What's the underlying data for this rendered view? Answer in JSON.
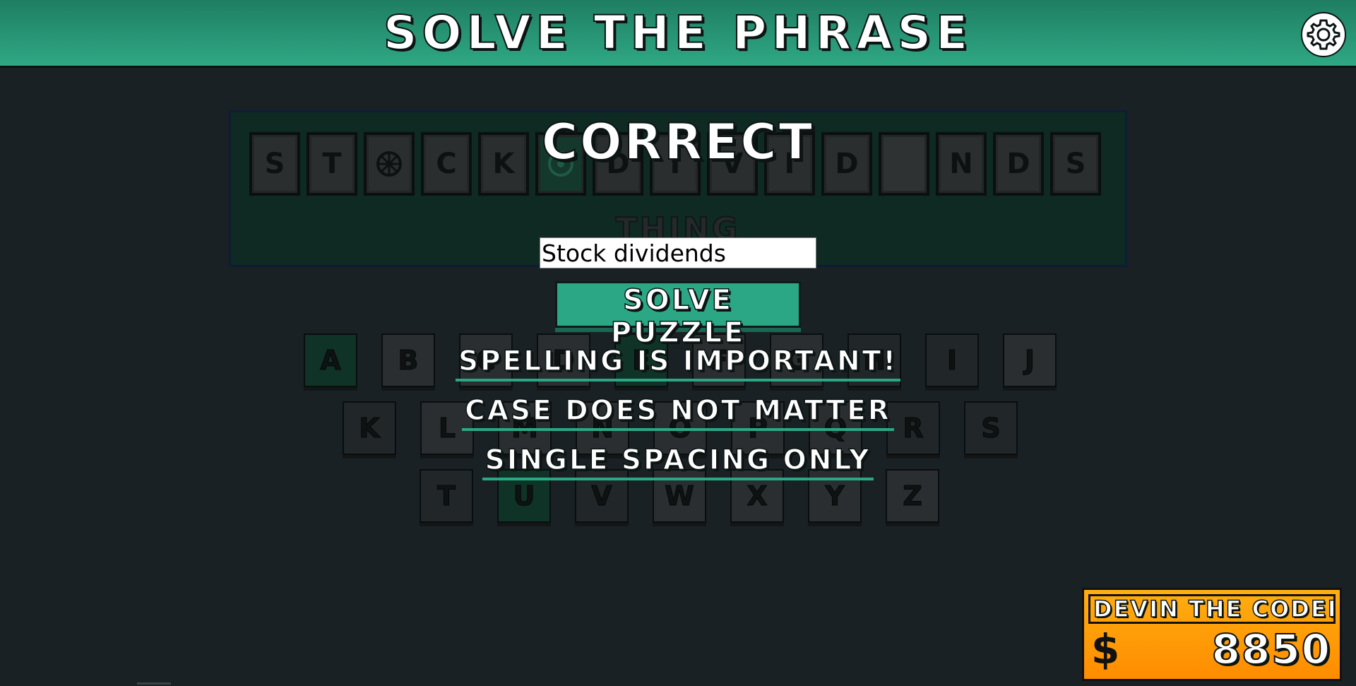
{
  "header": {
    "title": "SOLVE THE PHRASE",
    "settings_icon": "gear-icon"
  },
  "board": {
    "tiles": [
      "S",
      "T",
      "",
      "C",
      "K",
      "",
      "D",
      "I",
      "V",
      "I",
      "D",
      "",
      "N",
      "D",
      "S"
    ],
    "category": "THING"
  },
  "keyboard": {
    "row1": [
      "A",
      "B",
      "C",
      "D",
      "E",
      "F",
      "G",
      "H",
      "I",
      "J"
    ],
    "row2": [
      "K",
      "L",
      "M",
      "N",
      "O",
      "P",
      "Q",
      "R",
      "S"
    ],
    "row3": [
      "T",
      "U",
      "V",
      "W",
      "X",
      "Y",
      "Z"
    ]
  },
  "modal": {
    "title": "CORRECT",
    "input_value": "Stock dividends",
    "solve_button": "SOLVE PUZZLE",
    "rules": [
      "SPELLING IS IMPORTANT!",
      "CASE DOES NOT MATTER",
      "SINGLE SPACING ONLY"
    ]
  },
  "player": {
    "name": "DEVIN THE CODER",
    "currency": "$",
    "amount": "8850"
  },
  "colors": {
    "accent": "#2ca785",
    "player_box": "#ff9a00",
    "background": "#1a2124"
  }
}
